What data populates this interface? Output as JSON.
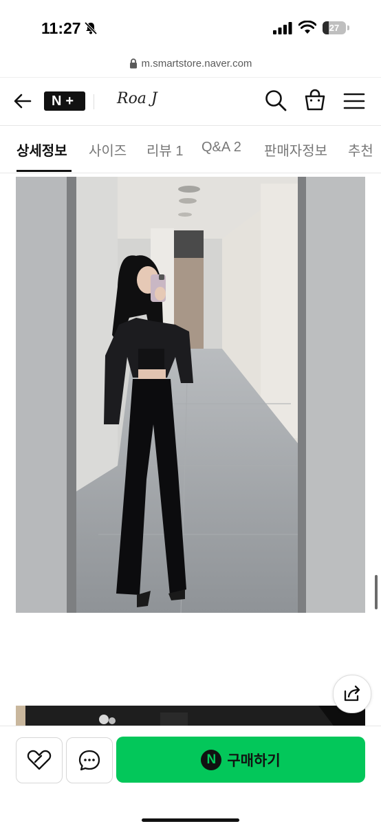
{
  "status_bar": {
    "time": "11:27",
    "battery": "27",
    "battery_level": 0.27
  },
  "browser": {
    "url": "m.smartstore.naver.com"
  },
  "header": {
    "logo": "N+",
    "store_name": "Roa J"
  },
  "tabs": [
    {
      "label": "상세정보",
      "active": true
    },
    {
      "label": "사이즈",
      "active": false
    },
    {
      "label": "리뷰 1",
      "active": false
    },
    {
      "label": "Q&A 2",
      "active": false
    },
    {
      "label": "판매자정보",
      "active": false
    },
    {
      "label": "추천",
      "active": false
    }
  ],
  "bottom_bar": {
    "buy_label": "구매하기",
    "npay_icon": "N"
  },
  "colors": {
    "brand_green": "#03c75a",
    "text_dark": "#111111"
  },
  "icons": [
    "bell-off-icon",
    "signal-icon",
    "wifi-icon",
    "lock-icon",
    "back-arrow-icon",
    "search-icon",
    "shopping-bag-icon",
    "menu-icon",
    "share-icon",
    "heart-link-icon",
    "chat-bubble-icon",
    "npay-icon"
  ]
}
